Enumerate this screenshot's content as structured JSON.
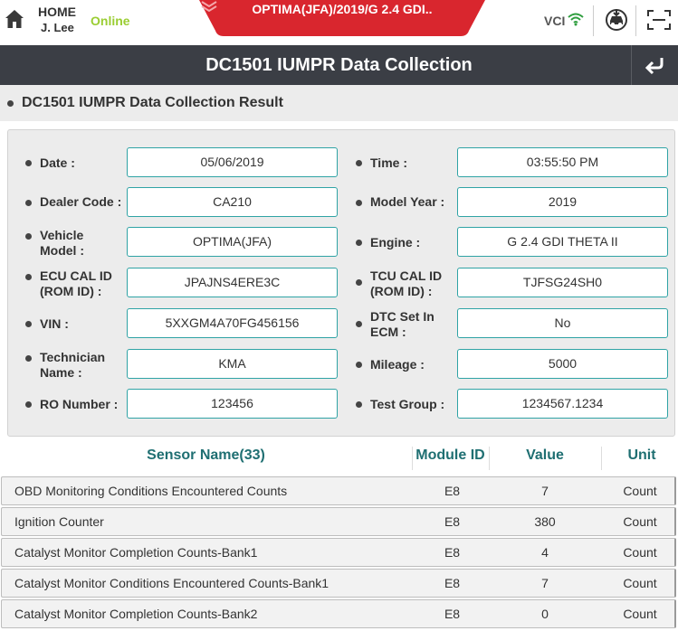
{
  "topbar": {
    "home_label": "HOME",
    "user": "J. Lee",
    "status": "Online",
    "vehicle": "OPTIMA(JFA)/2019/G 2.4 GDI..",
    "vci_label": "VCI",
    "colors": {
      "online": "#9acd32",
      "vehicle_tab": "#d9262e",
      "wifi": "#2e9e3e"
    }
  },
  "header": {
    "title": "DC1501 IUMPR Data Collection"
  },
  "section": {
    "title": "DC1501 IUMPR Data Collection Result"
  },
  "fields": {
    "date": {
      "label": "Date :",
      "value": "05/06/2019"
    },
    "time": {
      "label": "Time :",
      "value": "03:55:50 PM"
    },
    "dealer_code": {
      "label": "Dealer Code :",
      "value": "CA210"
    },
    "model_year": {
      "label": "Model Year :",
      "value": "2019"
    },
    "vehicle_model": {
      "label_1": "Vehicle",
      "label_2": "Model :",
      "value": "OPTIMA(JFA)"
    },
    "engine": {
      "label": "Engine :",
      "value": "G 2.4 GDI THETA II"
    },
    "ecu_cal_id": {
      "label_1": "ECU CAL ID",
      "label_2": "(ROM ID) :",
      "value": "JPAJNS4ERE3C"
    },
    "tcu_cal_id": {
      "label_1": "TCU CAL ID",
      "label_2": "(ROM ID) :",
      "value": "TJFSG24SH0"
    },
    "vin": {
      "label": "VIN :",
      "value": "5XXGM4A70FG456156"
    },
    "dtc_set": {
      "label_1": "DTC Set In",
      "label_2": "ECM :",
      "value": "No"
    },
    "technician": {
      "label_1": "Technician",
      "label_2": "Name :",
      "value": "KMA"
    },
    "mileage": {
      "label": "Mileage :",
      "value": "5000"
    },
    "ro_number": {
      "label": "RO Number :",
      "value": "123456"
    },
    "test_group": {
      "label": "Test Group :",
      "value": "1234567.1234"
    }
  },
  "table": {
    "headers": {
      "sensor": "Sensor Name(33)",
      "module": "Module ID",
      "value": "Value",
      "unit": "Unit"
    },
    "rows": [
      {
        "name": "OBD Monitoring Conditions Encountered Counts",
        "module": "E8",
        "value": "7",
        "unit": "Count"
      },
      {
        "name": "Ignition Counter",
        "module": "E8",
        "value": "380",
        "unit": "Count"
      },
      {
        "name": "Catalyst Monitor Completion Counts-Bank1",
        "module": "E8",
        "value": "4",
        "unit": "Count"
      },
      {
        "name": "Catalyst Monitor Conditions Encountered Counts-Bank1",
        "module": "E8",
        "value": "7",
        "unit": "Count"
      },
      {
        "name": "Catalyst Monitor Completion Counts-Bank2",
        "module": "E8",
        "value": "0",
        "unit": "Count"
      }
    ]
  }
}
